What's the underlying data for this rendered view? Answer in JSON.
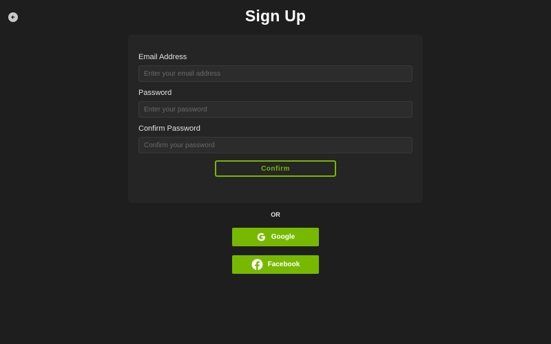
{
  "header": {
    "title": "Sign Up",
    "back_icon": "arrow-left-circle-icon"
  },
  "form": {
    "email": {
      "label": "Email Address",
      "placeholder": "Enter your email address",
      "value": ""
    },
    "password": {
      "label": "Password",
      "placeholder": "Enter your password",
      "value": ""
    },
    "confirm_password": {
      "label": "Confirm Password",
      "placeholder": "Confirm your password",
      "value": ""
    },
    "confirm_label": "Confirm"
  },
  "divider": {
    "text": "OR"
  },
  "social": {
    "google": {
      "label": "Google",
      "icon": "google-icon"
    },
    "facebook": {
      "label": "Facebook",
      "icon": "facebook-icon"
    }
  },
  "colors": {
    "background": "#1e1e1e",
    "card": "#252525",
    "accent": "#76b900",
    "input_bg": "#2c2c2c",
    "text": "#e6e6e6"
  }
}
